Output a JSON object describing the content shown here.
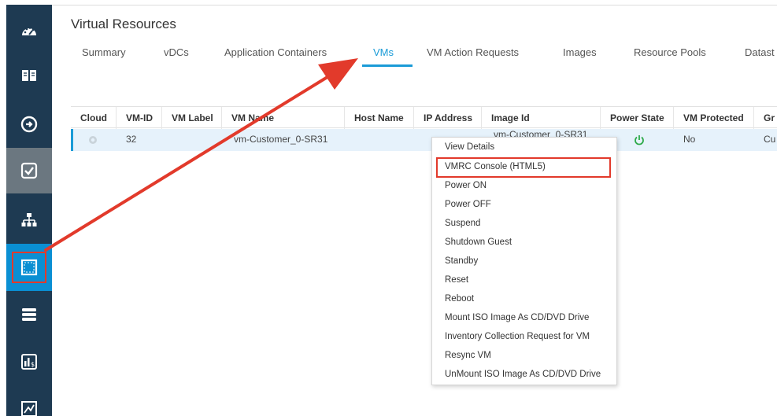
{
  "page": {
    "title": "Virtual Resources"
  },
  "tabs": [
    {
      "label": "Summary"
    },
    {
      "label": "vDCs"
    },
    {
      "label": "Application Containers"
    },
    {
      "label": "VMs",
      "active": true
    },
    {
      "label": "VM Action Requests"
    },
    {
      "label": "Images"
    },
    {
      "label": "Resource Pools"
    },
    {
      "label": "Datast"
    }
  ],
  "sidebar": {
    "items": [
      {
        "icon": "dashboard-icon"
      },
      {
        "icon": "book-icon"
      },
      {
        "icon": "policy-icon"
      },
      {
        "icon": "checkbox-icon",
        "state": "selected"
      },
      {
        "icon": "hierarchy-icon"
      },
      {
        "icon": "virtual-resources-icon",
        "state": "active"
      },
      {
        "icon": "server-stack-icon"
      },
      {
        "icon": "chargeback-icon"
      },
      {
        "icon": "reports-icon"
      }
    ]
  },
  "table": {
    "columns": [
      "Cloud",
      "VM-ID",
      "VM Label",
      "VM Name",
      "Host Name",
      "IP Address",
      "Image Id",
      "Power State",
      "VM Protected",
      "Gr"
    ],
    "rows": [
      {
        "cloud": "",
        "vm_id": "32",
        "vm_label": "",
        "vm_name": "vm-Customer_0-SR31",
        "host_name": "",
        "ip_address": "",
        "image_id": "vm-Customer_0-SR31",
        "power_state": "on",
        "vm_protected": "No",
        "group": "Cu"
      }
    ]
  },
  "context_menu": {
    "items": [
      "View Details",
      "VMRC Console (HTML5)",
      "Power ON",
      "Power OFF",
      "Suspend",
      "Shutdown Guest",
      "Standby",
      "Reset",
      "Reboot",
      "Mount ISO Image As CD/DVD Drive",
      "Inventory Collection Request for VM",
      "Resync VM",
      "UnMount ISO Image As CD/DVD Drive"
    ],
    "highlighted_index": 1
  },
  "colors": {
    "sidebar_bg": "#1e3a52",
    "sidebar_active": "#0a8fd3",
    "sidebar_selected": "#6b7780",
    "accent": "#1a9bd7",
    "annotation_red": "#e23a2b",
    "selected_row": "#e6f2fb",
    "power_on": "#2eaa4a"
  }
}
